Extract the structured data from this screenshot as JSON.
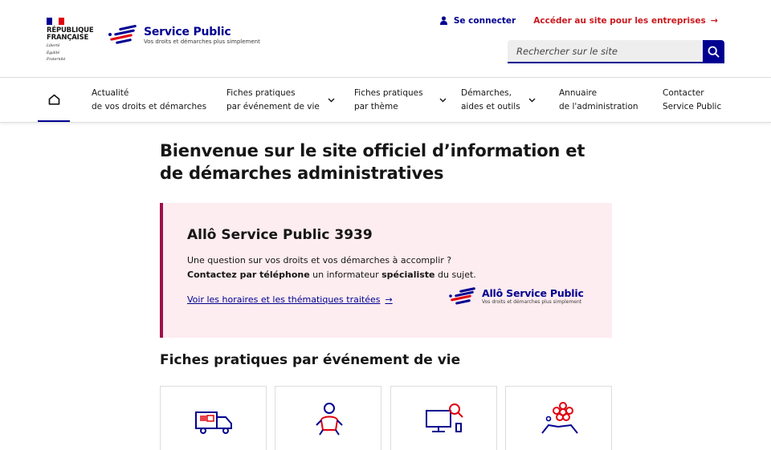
{
  "header": {
    "rf": {
      "line1": "RÉPUBLIQUE",
      "line2": "FRANÇAISE",
      "motto1": "Liberté",
      "motto2": "Égalité",
      "motto3": "Fraternité"
    },
    "logo": {
      "title": "Service Public",
      "subtitle": "Vos droits et démarches plus simplement"
    },
    "login_label": "Se connecter",
    "business_label": "Accéder au site pour les entreprises",
    "search": {
      "placeholder": "Rechercher sur le site"
    }
  },
  "nav": {
    "items": [
      {
        "line1": "Actualité",
        "line2": "de vos droits et démarches"
      },
      {
        "line1": "Fiches pratiques",
        "line2": "par événement de vie"
      },
      {
        "line1": "Fiches pratiques",
        "line2": "par thème"
      },
      {
        "line1": "Démarches,",
        "line2": "aides et outils"
      },
      {
        "line1": "Annuaire",
        "line2": "de l'administration"
      },
      {
        "line1": "Contacter",
        "line2": "Service Public"
      }
    ]
  },
  "main": {
    "title": "Bienvenue sur le site officiel d’information et de démarches administratives",
    "allo": {
      "title": "Allô Service Public 3939",
      "line1": "Une question sur vos droits et vos démarches à accomplir ?",
      "line2_bold1": "Contactez par téléphone",
      "line2_mid": " un informateur ",
      "line2_bold2": "spécialiste",
      "line2_end": " du sujet.",
      "link": "Voir les horaires et les thématiques traitées",
      "logo_title": "Allô Service Public",
      "logo_subtitle": "Vos droits et démarches plus simplement"
    },
    "section_title": "Fiches pratiques par événement de vie"
  },
  "colors": {
    "blue": "#000091",
    "red": "#e1000f",
    "accent": "#a10e4c",
    "pink_bg": "#fdecf0"
  }
}
